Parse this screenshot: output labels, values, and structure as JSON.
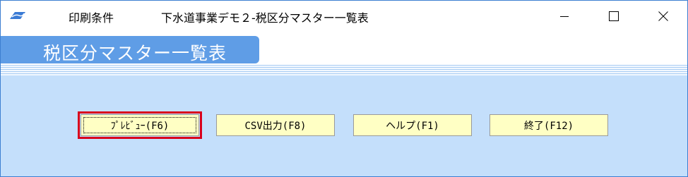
{
  "titlebar": {
    "menu_label": "印刷条件",
    "window_title": "下水道事業デモ２-税区分マスター一覧表",
    "min_icon": "minimize-icon",
    "max_icon": "maximize-icon",
    "close_icon": "close-icon"
  },
  "header": {
    "title": "税区分マスター一覧表",
    "tab_color": "#5f9de6"
  },
  "buttons": {
    "preview": "ﾌﾟﾚﾋﾞｭｰ(F6)",
    "csv": "CSV出力(F8)",
    "help": "ヘルプ(F1)",
    "exit": "終了(F12)"
  },
  "colors": {
    "content_bg": "#c4dffb",
    "button_bg": "#ffffc4",
    "focus_outline": "#d9001b"
  }
}
